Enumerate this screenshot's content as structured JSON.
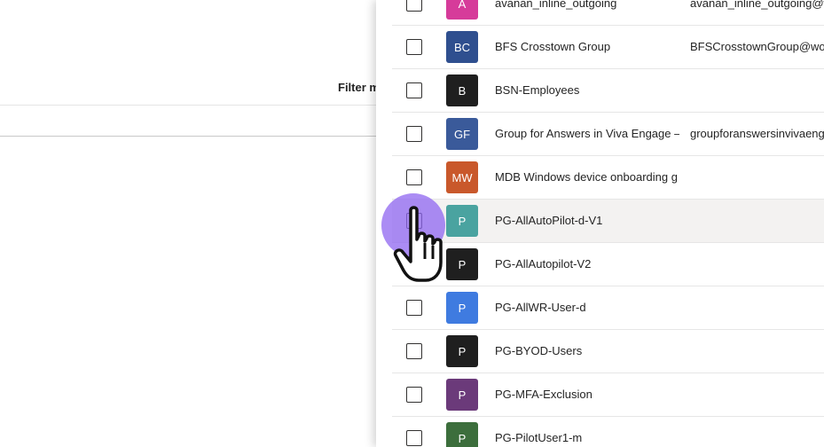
{
  "background": {
    "filter_label": "Filter m"
  },
  "colors": {
    "pink": "#d63b9a",
    "navy": "#2f4f8f",
    "black": "#1f1f1f",
    "blue_dark": "#3a5a9a",
    "orange": "#c9582b",
    "teal": "#4aa3a0",
    "blue": "#3f7be0",
    "purple": "#6b3a7a",
    "green": "#3c6e3c",
    "hover_bg": "#f3f2f1",
    "cursor_highlight": "#8f66f0"
  },
  "groups": [
    {
      "initials": "A",
      "name": "avanan_inline_outgoing",
      "email": "avanan_inline_outgoing@w",
      "color": "#d63b9a"
    },
    {
      "initials": "BC",
      "name": "BFS Crosstown Group",
      "email": "BFSCrosstownGroup@wor",
      "color": "#2f4f8f"
    },
    {
      "initials": "B",
      "name": "BSN-Employees",
      "email": "",
      "color": "#1f1f1f"
    },
    {
      "initials": "GF",
      "name": "Group for Answers in Viva Engage –",
      "email": "groupforanswersinvivaeng",
      "color": "#3a5a9a"
    },
    {
      "initials": "MW",
      "name": "MDB Windows device onboarding g",
      "email": "",
      "color": "#c9582b"
    },
    {
      "initials": "P",
      "name": "PG-AllAutoPilot-d-V1",
      "email": "",
      "color": "#4aa3a0",
      "hover": true
    },
    {
      "initials": "P",
      "name": "PG-AllAutopilot-V2",
      "email": "",
      "color": "#1f1f1f"
    },
    {
      "initials": "P",
      "name": "PG-AllWR-User-d",
      "email": "",
      "color": "#3f7be0"
    },
    {
      "initials": "P",
      "name": "PG-BYOD-Users",
      "email": "",
      "color": "#1f1f1f"
    },
    {
      "initials": "P",
      "name": "PG-MFA-Exclusion",
      "email": "",
      "color": "#6b3a7a"
    },
    {
      "initials": "P",
      "name": "PG-PilotUser1-m",
      "email": "",
      "color": "#3c6e3c"
    }
  ],
  "icons": {
    "cursor": "hand-pointer-icon"
  }
}
